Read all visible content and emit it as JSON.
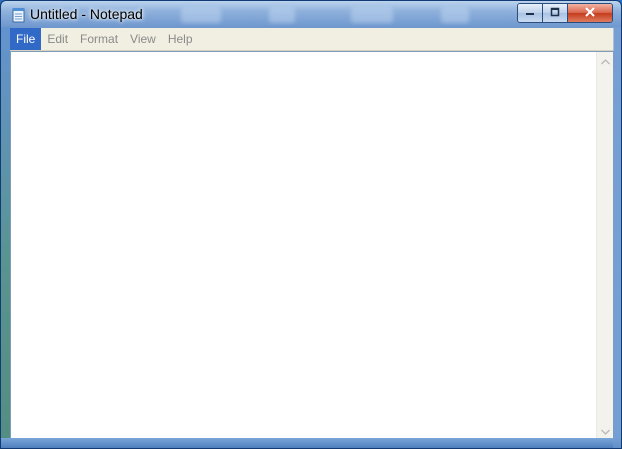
{
  "window": {
    "title": "Untitled - Notepad"
  },
  "menu": {
    "items": [
      {
        "label": "File",
        "active": true
      },
      {
        "label": "Edit",
        "active": false
      },
      {
        "label": "Format",
        "active": false
      },
      {
        "label": "View",
        "active": false
      },
      {
        "label": "Help",
        "active": false
      }
    ]
  },
  "editor": {
    "content": ""
  },
  "icons": {
    "app": "notepad-icon",
    "minimize": "minimize-icon",
    "maximize": "maximize-icon",
    "close": "close-icon",
    "scroll_up": "arrow-up-icon",
    "scroll_down": "arrow-down-icon"
  },
  "colors": {
    "menu_active_bg": "#3169c6",
    "menu_text_disabled": "#8a8a8a",
    "menubar_bg": "#f1efe2",
    "close_button": "#c43c1d"
  }
}
